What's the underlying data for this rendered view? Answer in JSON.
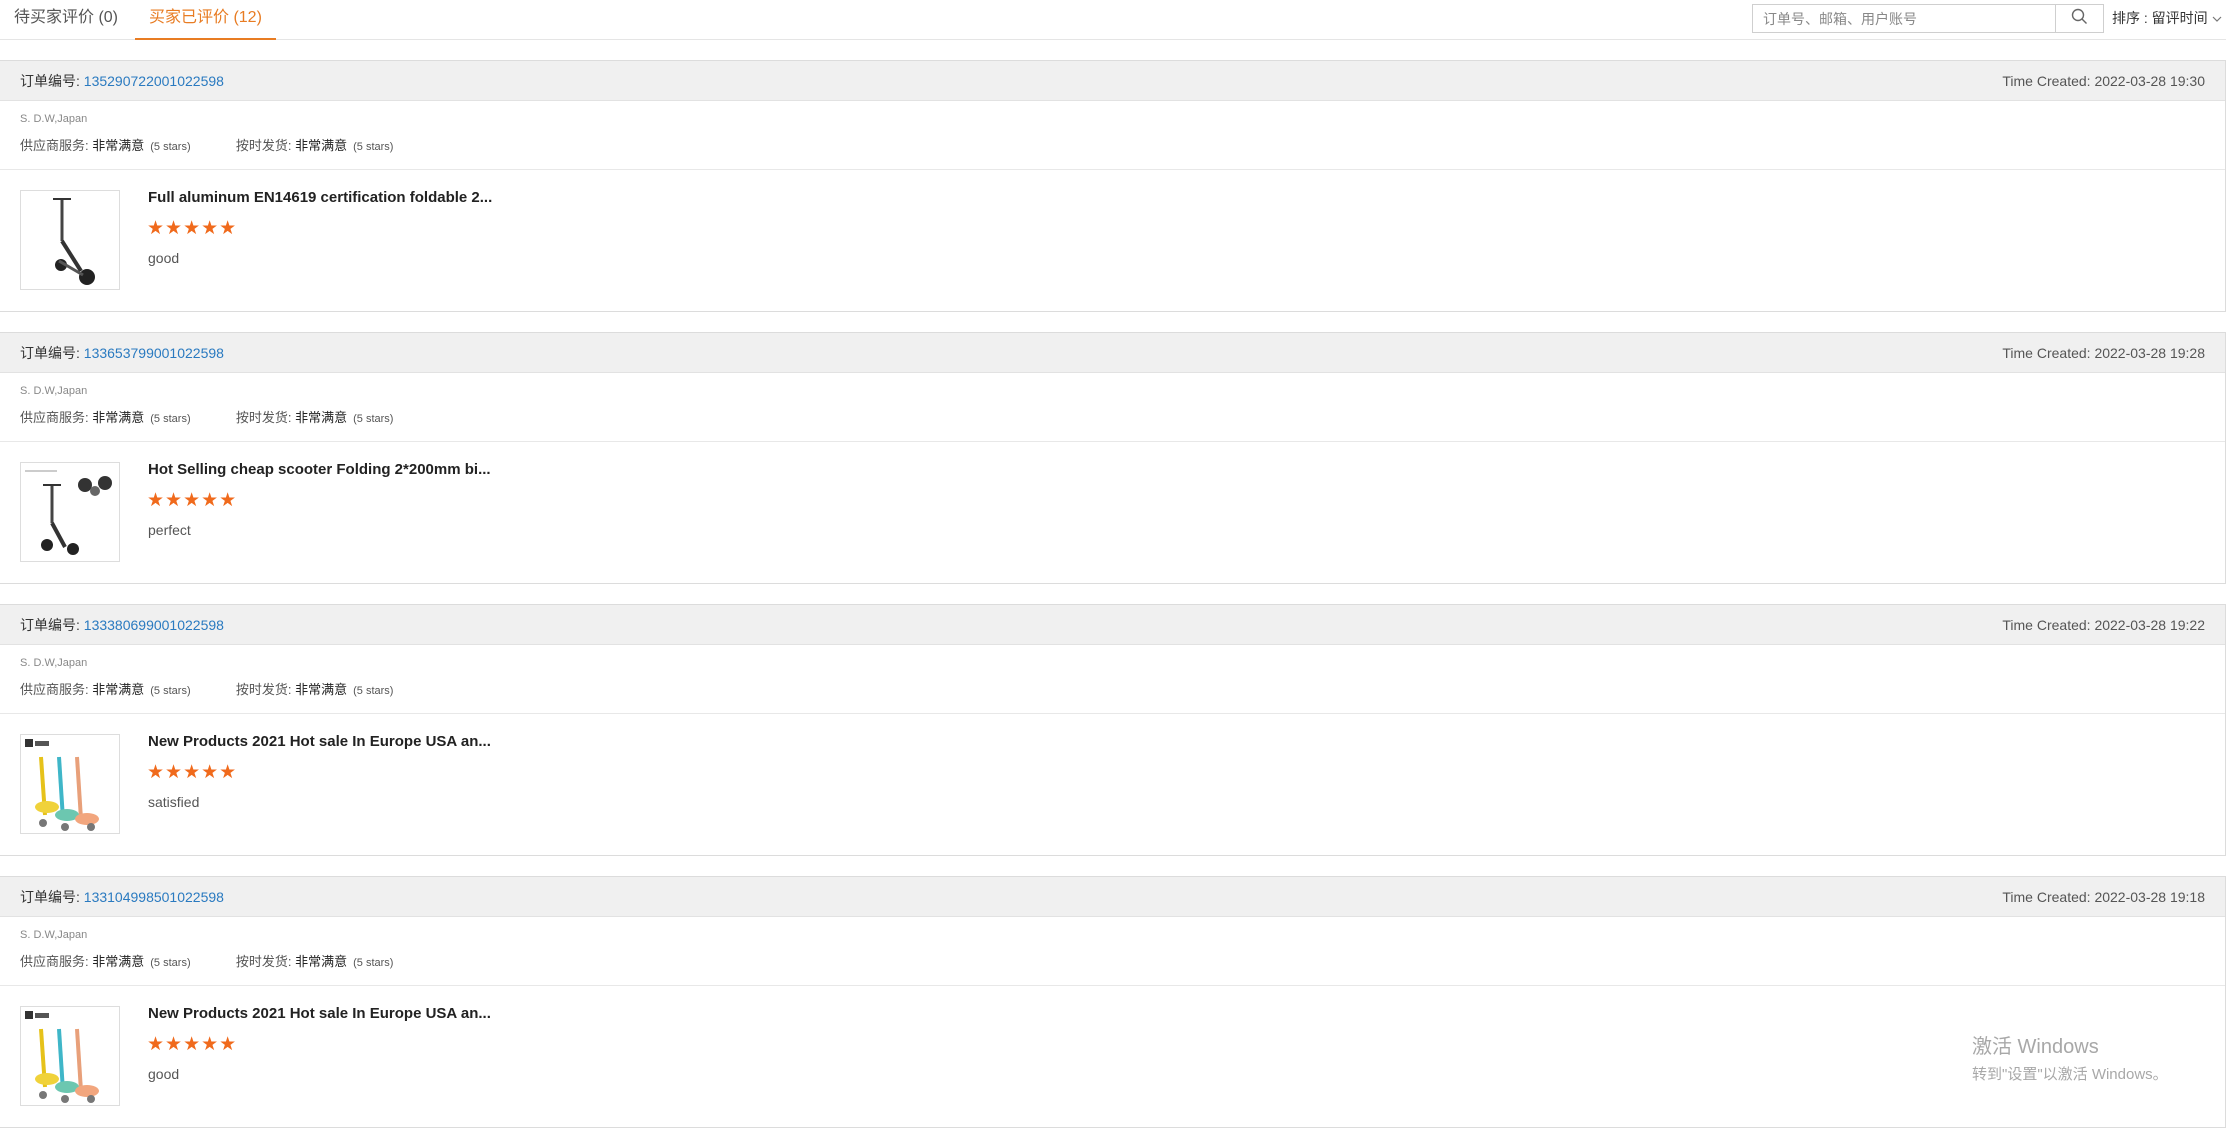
{
  "tabs": [
    {
      "label": "待买家评价 (0)"
    },
    {
      "label": "买家已评价 (12)"
    }
  ],
  "search": {
    "placeholder": "订单号、邮箱、用户账号",
    "icon": "search-icon"
  },
  "sort": {
    "label": "排序 : 留评时间"
  },
  "order_label": "订单编号:",
  "time_label": "Time Created:",
  "rating_labels": {
    "service": "供应商服务:",
    "delivery": "按时发货:"
  },
  "orders": [
    {
      "number": "135290722001022598",
      "time": "2022-03-28 19:30",
      "seller": "S. D.W,Japan",
      "service_value": "非常满意",
      "service_stars": "(5 stars)",
      "delivery_value": "非常满意",
      "delivery_stars": "(5 stars)",
      "product_title": "Full aluminum EN14619 certification foldable 2...",
      "stars": "★★★★★",
      "rating": 5,
      "comment": "good"
    },
    {
      "number": "133653799001022598",
      "time": "2022-03-28 19:28",
      "seller": "S. D.W,Japan",
      "service_value": "非常满意",
      "service_stars": "(5 stars)",
      "delivery_value": "非常满意",
      "delivery_stars": "(5 stars)",
      "product_title": "Hot Selling cheap scooter Folding 2*200mm bi...",
      "stars": "★★★★★",
      "rating": 5,
      "comment": "perfect"
    },
    {
      "number": "133380699001022598",
      "time": "2022-03-28 19:22",
      "seller": "S. D.W,Japan",
      "service_value": "非常满意",
      "service_stars": "(5 stars)",
      "delivery_value": "非常满意",
      "delivery_stars": "(5 stars)",
      "product_title": "New Products 2021 Hot sale In Europe USA an...",
      "stars": "★★★★★",
      "rating": 5,
      "comment": "satisfied"
    },
    {
      "number": "133104998501022598",
      "time": "2022-03-28 19:18",
      "seller": "S. D.W,Japan",
      "service_value": "非常满意",
      "service_stars": "(5 stars)",
      "delivery_value": "非常满意",
      "delivery_stars": "(5 stars)",
      "product_title": "New Products 2021 Hot sale In Europe USA an...",
      "stars": "★★★★★",
      "rating": 5,
      "comment": "good"
    }
  ],
  "watermark": {
    "line1": "激活 Windows",
    "line2": "转到\"设置\"以激活 Windows。"
  },
  "colors": {
    "accent": "#e87c23",
    "link": "#2a7ac0",
    "star": "#f06a1c"
  }
}
